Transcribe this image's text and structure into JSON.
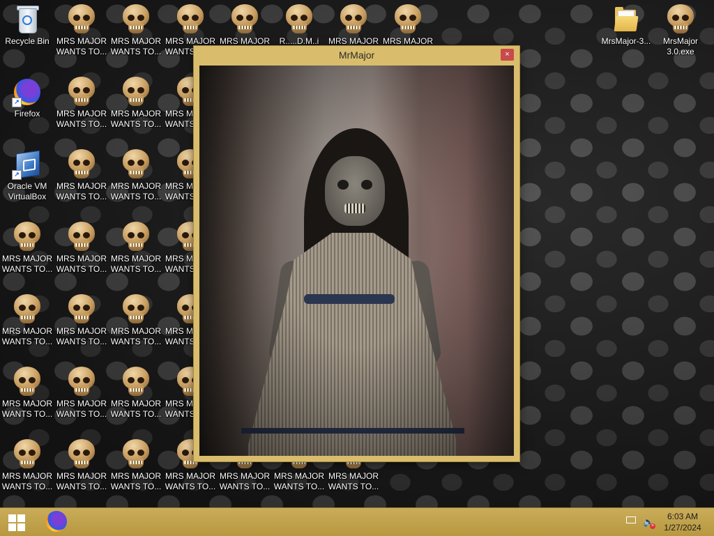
{
  "desktop": {
    "icons": {
      "recycle_bin": "Recycle Bin",
      "firefox": "Firefox",
      "virtualbox": "Oracle VM\nVirtualBox",
      "folder": "MrsMajor-3...",
      "exe": "MrsMajor\n3.0.exe",
      "skull_label": "MRS MAJOR\nWANTS TO...",
      "partial_label": "R.....D.M..i"
    }
  },
  "window": {
    "title": "MrMajor",
    "close_glyph": "×"
  },
  "taskbar": {
    "clock_time": "6:03 AM",
    "clock_date": "1/27/2024"
  },
  "colors": {
    "taskbar": "#c9ac5a",
    "window_frame": "#d9bd6c",
    "close_button": "#c84a4a"
  }
}
